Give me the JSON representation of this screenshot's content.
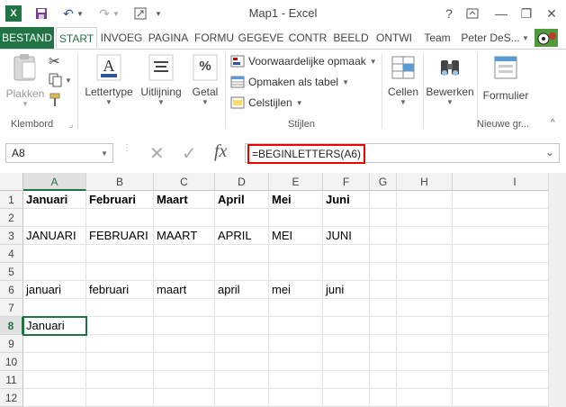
{
  "window": {
    "title": "Map1 - Excel"
  },
  "title_buttons": {
    "help": "?",
    "minimize": "—",
    "restore": "❐",
    "close": "✕"
  },
  "tabs": [
    "BESTAND",
    "START",
    "INVOEG",
    "PAGINA",
    "FORMU",
    "GEGEVE",
    "CONTR",
    "BEELD",
    "ONTWI",
    "Team"
  ],
  "user": "Peter DeS...",
  "ribbon": {
    "paste": "Plakken",
    "clipboard_group": "Klembord",
    "font": "Lettertype",
    "alignment": "Uitlijning",
    "number": "Getal",
    "number_icon": "%",
    "cond_format": "Voorwaardelijke opmaak",
    "format_table": "Opmaken als tabel",
    "cell_styles": "Celstijlen",
    "styles_group": "Stijlen",
    "cells": "Cellen",
    "editing": "Bewerken",
    "form": "Formulier",
    "new_group": "Nieuwe gr..."
  },
  "formula_bar": {
    "name_box": "A8",
    "fx": "fx",
    "formula": "=BEGINLETTERS(A6)"
  },
  "columns": [
    "A",
    "B",
    "C",
    "D",
    "E",
    "F",
    "G",
    "H",
    "I"
  ],
  "rows": [
    "1",
    "2",
    "3",
    "4",
    "5",
    "6",
    "7",
    "8",
    "9",
    "10",
    "11",
    "12"
  ],
  "cells": {
    "r1": [
      "Januari",
      "Februari",
      "Maart",
      "April",
      "Mei",
      "Juni"
    ],
    "r3": [
      "JANUARI",
      "FEBRUARI",
      "MAART",
      "APRIL",
      "MEI",
      "JUNI"
    ],
    "r6": [
      "januari",
      "februari",
      "maart",
      "april",
      "mei",
      "juni"
    ],
    "r8": [
      "Januari"
    ]
  },
  "colors": {
    "excel_green": "#217346",
    "highlight_red": "#e00000"
  }
}
